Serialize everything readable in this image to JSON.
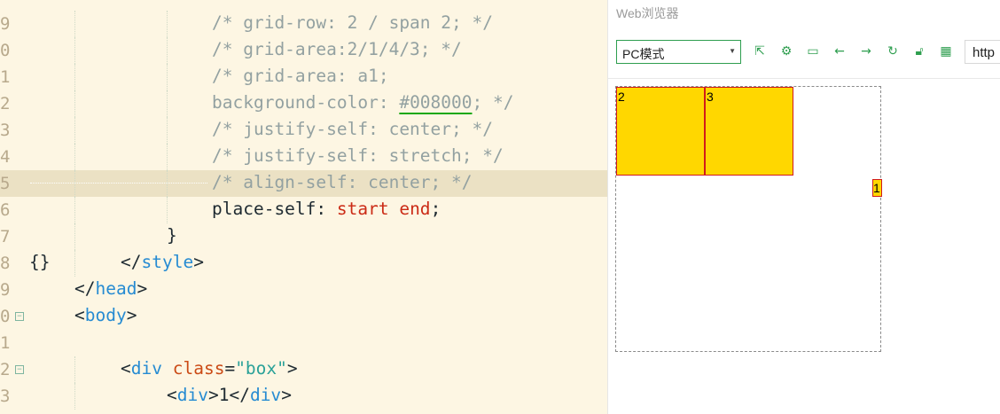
{
  "editor": {
    "lines": [
      {
        "num": "9",
        "fold": false,
        "segments": [
          {
            "t": "/* grid-row: 2 / span 2; */",
            "c": "comment"
          }
        ],
        "indent": 239
      },
      {
        "num": "0",
        "fold": false,
        "segments": [
          {
            "t": "/* grid-area:2/1/4/3; */",
            "c": "comment"
          }
        ],
        "indent": 239
      },
      {
        "num": "1",
        "fold": false,
        "segments": [
          {
            "t": "/* grid-area: a1;",
            "c": "comment"
          }
        ],
        "indent": 239
      },
      {
        "num": "2",
        "fold": false,
        "segments": [
          {
            "t": "background-color: ",
            "c": "comment"
          },
          {
            "t": "#008000",
            "c": "comment hex"
          },
          {
            "t": "; */",
            "c": "comment"
          }
        ],
        "indent": 239
      },
      {
        "num": "3",
        "fold": false,
        "segments": [
          {
            "t": "/* justify-self: center; */",
            "c": "comment"
          }
        ],
        "indent": 239
      },
      {
        "num": "4",
        "fold": false,
        "segments": [
          {
            "t": "/* justify-self: stretch; */",
            "c": "comment"
          }
        ],
        "indent": 239
      },
      {
        "num": "5",
        "fold": false,
        "current": true,
        "segments": [
          {
            "t": "/* align-self: center; */",
            "c": "comment"
          }
        ],
        "indent": 239
      },
      {
        "num": "6",
        "fold": false,
        "segments": [
          {
            "t": "place-self: ",
            "c": "plain"
          },
          {
            "t": "start end",
            "c": "val"
          },
          {
            "t": ";",
            "c": "plain"
          }
        ],
        "indent": 239
      },
      {
        "num": "7",
        "fold": false,
        "segments": [
          {
            "t": "}",
            "c": "plain"
          }
        ],
        "indent": 188
      },
      {
        "num": "8",
        "fold": false,
        "segments": [
          {
            "t": "</",
            "c": "plain"
          },
          {
            "t": "style",
            "c": "tag"
          },
          {
            "t": ">",
            "c": "plain"
          }
        ],
        "indent": 136,
        "prefix": "{}"
      },
      {
        "num": "9",
        "fold": false,
        "segments": [
          {
            "t": "</",
            "c": "plain"
          },
          {
            "t": "head",
            "c": "tag"
          },
          {
            "t": ">",
            "c": "plain"
          }
        ],
        "indent": 84
      },
      {
        "num": "0",
        "fold": true,
        "segments": [
          {
            "t": "<",
            "c": "plain"
          },
          {
            "t": "body",
            "c": "tag"
          },
          {
            "t": ">",
            "c": "plain"
          }
        ],
        "indent": 84
      },
      {
        "num": "1",
        "fold": false,
        "segments": [],
        "indent": 84
      },
      {
        "num": "2",
        "fold": true,
        "segments": [
          {
            "t": "<",
            "c": "plain"
          },
          {
            "t": "div",
            "c": "tag"
          },
          {
            "t": " ",
            "c": "plain"
          },
          {
            "t": "class",
            "c": "attr"
          },
          {
            "t": "=",
            "c": "plain"
          },
          {
            "t": "\"box\"",
            "c": "str"
          },
          {
            "t": ">",
            "c": "plain"
          }
        ],
        "indent": 136
      },
      {
        "num": "3",
        "fold": false,
        "segments": [
          {
            "t": "<",
            "c": "plain"
          },
          {
            "t": "div",
            "c": "tag"
          },
          {
            "t": ">1</",
            "c": "plain"
          },
          {
            "t": "div",
            "c": "tag"
          },
          {
            "t": ">",
            "c": "plain"
          }
        ],
        "indent": 188
      }
    ]
  },
  "browser": {
    "title": "Web浏览器",
    "mode_select": "PC模式",
    "url_text": "http",
    "toolbar_icons": [
      "open-external-icon",
      "settings-icon",
      "terminal-icon",
      "back-icon",
      "forward-icon",
      "refresh-icon",
      "lock-icon",
      "qr-code-icon"
    ],
    "accent": "#2e9e4f"
  },
  "page": {
    "cells": [
      {
        "label": "2",
        "fill": "#ffd700",
        "border": "#d11b1b"
      },
      {
        "label": "3",
        "fill": "#ffd700",
        "border": "#d11b1b"
      },
      {
        "label": "1",
        "fill": "#ffd700",
        "border": "#d11b1b"
      }
    ]
  }
}
